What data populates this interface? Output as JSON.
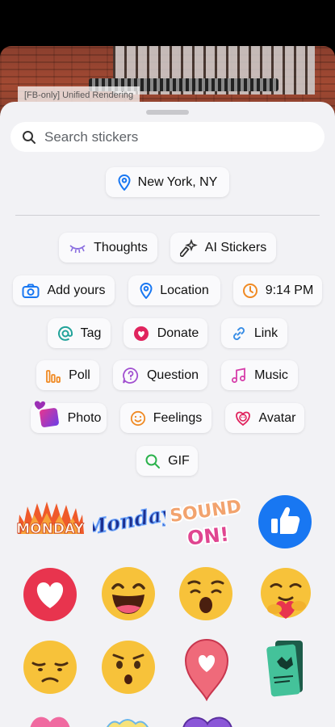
{
  "background": {
    "badge": "[FB-only] Unified Rendering"
  },
  "search": {
    "placeholder": "Search stickers"
  },
  "location_suggestion": "New York, NY",
  "chips": {
    "thoughts": "Thoughts",
    "ai_stickers": "AI Stickers",
    "add_yours": "Add yours",
    "location": "Location",
    "time": "9:14 PM",
    "tag": "Tag",
    "donate": "Donate",
    "link": "Link",
    "poll": "Poll",
    "question": "Question",
    "music": "Music",
    "photo": "Photo",
    "feelings": "Feelings",
    "avatar": "Avatar",
    "gif": "GIF"
  },
  "stickers": {
    "monday_flames": "MONDAY",
    "monday_script": "Monday",
    "sound_on": [
      "SOUND",
      "ON!"
    ],
    "items": [
      "monday-flames",
      "monday-script",
      "sound-on",
      "like-thumb",
      "heart-circle",
      "laughing-emoji",
      "wow-emoji",
      "care-emoji",
      "sad-emoji",
      "surprised-emoji",
      "heart-pin",
      "scratch-card"
    ]
  },
  "colors": {
    "accent_blue": "#1877f2",
    "donate_red": "#e0245e",
    "music_pink": "#d63eaa",
    "poll_orange": "#f08a24",
    "tag_teal": "#22a39a",
    "gif_green": "#2bb24c"
  }
}
